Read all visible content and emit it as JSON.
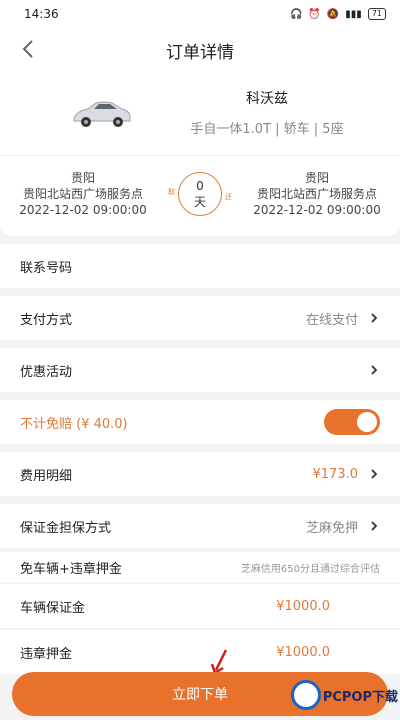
{
  "status": {
    "time": "14:36",
    "battery": "71"
  },
  "header": {
    "title": "订单详情"
  },
  "car": {
    "name": "科沃兹",
    "spec": "手自一体1.0T | 轿车 | 5座"
  },
  "route": {
    "pickup": {
      "city": "贵阳",
      "place": "贵阳北站西广场服务点",
      "datetime": "2022-12-02 09:00:00"
    },
    "return": {
      "city": "贵阳",
      "place": "贵阳北站西广场服务点",
      "datetime": "2022-12-02 09:00:00"
    },
    "days": "0",
    "days_unit": "天",
    "tag_left": "取",
    "tag_right": "还"
  },
  "rows": {
    "contact": {
      "label": "联系号码"
    },
    "payment": {
      "label": "支付方式",
      "value": "在线支付"
    },
    "promo": {
      "label": "优惠活动"
    },
    "insurance": {
      "label": "不计免赔 (¥ 40.0)",
      "enabled": true
    },
    "fees": {
      "label": "费用明细",
      "value": "¥173.0"
    },
    "guarantee": {
      "label": "保证金担保方式",
      "value": "芝麻免押"
    }
  },
  "exempt": {
    "label": "免车辆+违章押金",
    "note": "芝麻信用650分且通过综合评估"
  },
  "deposits": {
    "vehicle": {
      "label": "车辆保证金",
      "value": "¥1000.0"
    },
    "violation": {
      "label": "违章押金",
      "value": "¥1000.0"
    }
  },
  "order_button": "立即下单",
  "watermark": "PCPOP下载",
  "colors": {
    "accent": "#e8722c"
  }
}
